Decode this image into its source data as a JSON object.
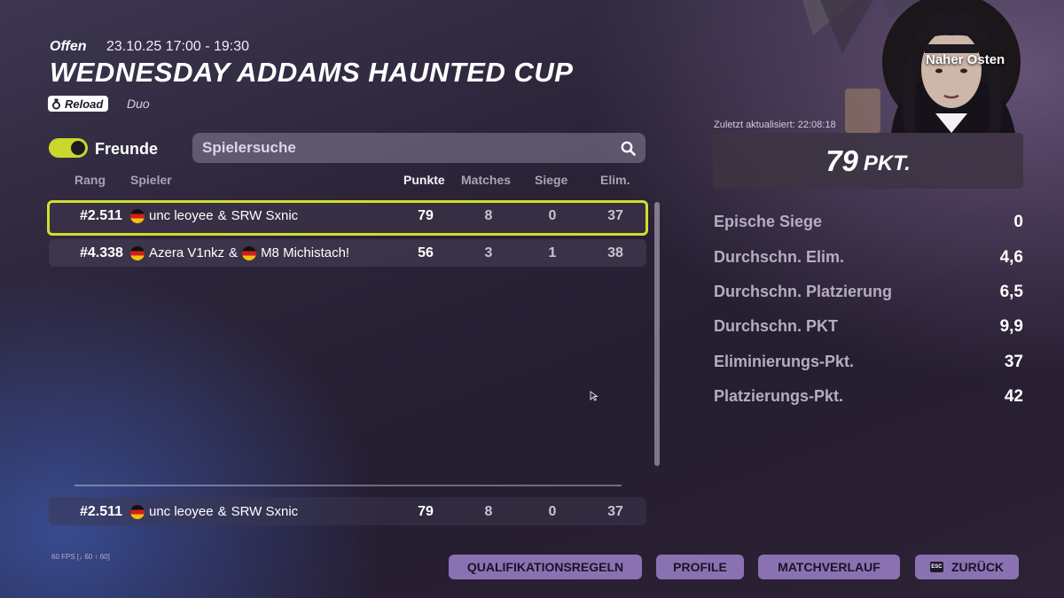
{
  "header": {
    "status": "Offen",
    "datetime": "23.10.25 17:00 - 19:30",
    "title": "WEDNESDAY ADDAMS HAUNTED CUP",
    "mode": "Reload",
    "team_mode": "Duo"
  },
  "filters": {
    "friends_label": "Freunde",
    "friends_on": true,
    "search_placeholder": "Spielersuche"
  },
  "table": {
    "columns": [
      "Rang",
      "Spieler",
      "Punkte",
      "Matches",
      "Siege",
      "Elim."
    ],
    "rows": [
      {
        "rank": "#2.511",
        "player1": "unc leoyee",
        "player2": "SRW Sxnic",
        "points": "79",
        "matches": "8",
        "wins": "0",
        "elims": "37",
        "selected": true
      },
      {
        "rank": "#4.338",
        "player1": "Azera V1nkz",
        "player2": "M8 Michistach!",
        "points": "56",
        "matches": "3",
        "wins": "1",
        "elims": "38",
        "selected": false
      }
    ],
    "pinned": {
      "rank": "#2.511",
      "player1": "unc leoyee",
      "player2": "SRW Sxnic",
      "points": "79",
      "matches": "8",
      "wins": "0",
      "elims": "37"
    }
  },
  "panel": {
    "region": "Naher Osten",
    "updated": "Zuletzt aktualisiert: 22:08:18",
    "points": "79",
    "points_unit": "PKT.",
    "stats": [
      {
        "label": "Epische Siege",
        "value": "0"
      },
      {
        "label": "Durchschn. Elim.",
        "value": "4,6"
      },
      {
        "label": "Durchschn. Platzierung",
        "value": "6,5"
      },
      {
        "label": "Durchschn. PKT",
        "value": "9,9"
      },
      {
        "label": "Eliminierungs-Pkt.",
        "value": "37"
      },
      {
        "label": "Platzierungs-Pkt.",
        "value": "42"
      }
    ]
  },
  "footer": {
    "fps": "60 FPS [↓ 60 ↑ 60]",
    "buttons": [
      "QUALIFIKATIONSREGELN",
      "PROFILE",
      "MATCHVERLAUF",
      "ZURÜCK"
    ],
    "esc_key": "ESC"
  },
  "colors": {
    "accent": "#d3dd2b",
    "button": "#8a72b2"
  },
  "icons": [
    "reload-icon",
    "search-icon",
    "flag-de-icon",
    "esc-key-icon",
    "cursor-icon"
  ]
}
